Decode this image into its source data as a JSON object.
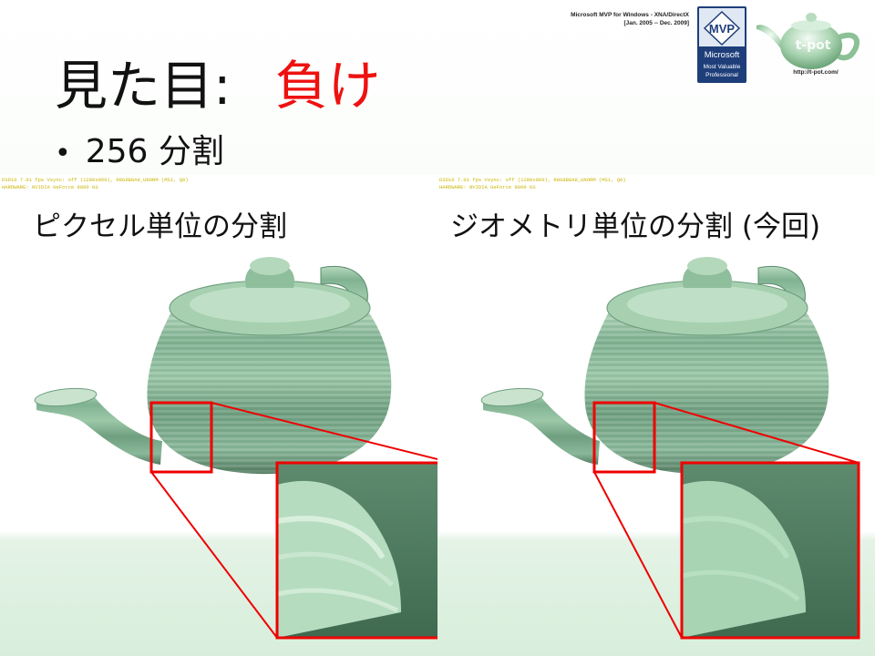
{
  "header": {
    "mvp_line1": "Microsoft MVP for Windows - XNA/DirectX",
    "mvp_line2": "[Jan. 2005 -- Dec. 2009]",
    "badge_top": "MVP",
    "badge_line1": "Microsoft",
    "badge_line2": "Most Valuable",
    "badge_line3": "Professional",
    "logo_text": "t-pot",
    "logo_url": "http://t-pot.com/"
  },
  "slide": {
    "title_main": "見た目:",
    "title_accent": "負け",
    "bullet": "256 分割"
  },
  "panels": [
    {
      "label": "ピクセル単位の分割",
      "debug_line1": "D3D10 7.01 fps Vsync: off (1280x960), R8G8B8A8_UNORM (MS1, Q0)",
      "debug_line2": "HARDWARE: NVIDIA GeForce 8800 GS"
    },
    {
      "label": "ジオメトリ単位の分割 (今回)",
      "debug_line1": "D3D10 7.01 fps Vsync: off (1280x960), R8G8B8A8_UNORM (MS1, Q0)",
      "debug_line2": "HARDWARE: NVIDIA GeForce 8800 GS"
    }
  ],
  "colors": {
    "accent_red": "#ee1111",
    "teapot_green": "#6fa585",
    "frame_red": "#ee0000",
    "badge_blue": "#1e3e7a"
  }
}
